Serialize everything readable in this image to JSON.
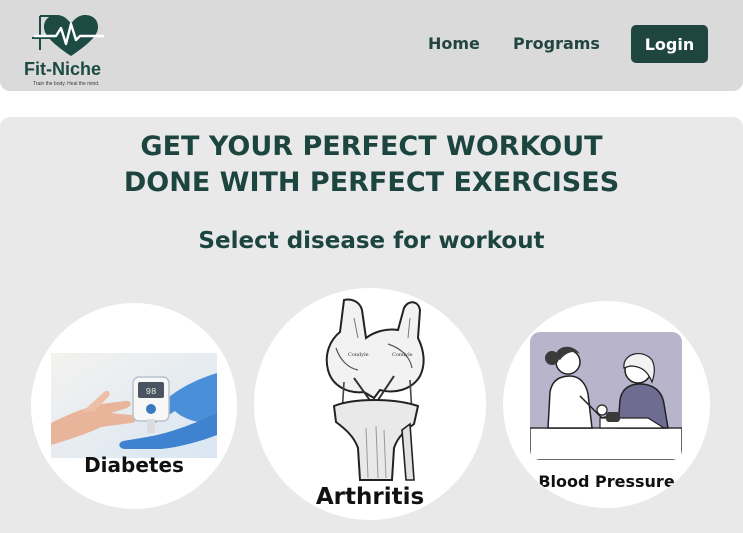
{
  "header": {
    "brand": "Fit-Niche",
    "tagline": "Train the body. Heal the mind.",
    "nav": [
      {
        "label": "Home"
      },
      {
        "label": "Programs"
      }
    ],
    "login_label": "Login"
  },
  "main": {
    "headline_line1": "GET YOUR PERFECT WORKOUT",
    "headline_line2": "DONE WITH PERFECT EXERCISES",
    "subheading": "Select disease for workout",
    "cards": [
      {
        "label": "Diabetes"
      },
      {
        "label": "Arthritis"
      },
      {
        "label": "Blood Pressure"
      }
    ]
  },
  "colors": {
    "brand_green": "#1e4540",
    "header_bg": "#dadada",
    "main_bg": "#e9e9e9"
  }
}
